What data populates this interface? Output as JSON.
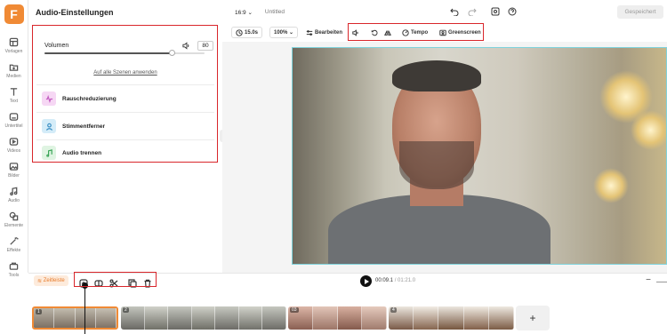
{
  "app": {
    "logo_letter": "F",
    "brand_color": "#f08a35"
  },
  "sidebar": {
    "items": [
      {
        "label": "Vorlagen",
        "icon": "template-icon"
      },
      {
        "label": "Medien",
        "icon": "media-icon"
      },
      {
        "label": "Text",
        "icon": "text-icon"
      },
      {
        "label": "Untertitel",
        "icon": "subtitles-icon"
      },
      {
        "label": "Videos",
        "icon": "video-icon"
      },
      {
        "label": "Bilder",
        "icon": "image-icon"
      },
      {
        "label": "Audio",
        "icon": "audio-icon"
      },
      {
        "label": "Elemente",
        "icon": "elements-icon"
      },
      {
        "label": "Effekte",
        "icon": "effects-icon"
      },
      {
        "label": "Tools",
        "icon": "tools-icon"
      }
    ]
  },
  "panel": {
    "title": "Audio-Einstellungen",
    "volume": {
      "label": "Volumen",
      "value": "80",
      "level_fraction": 0.8
    },
    "apply_all": "Auf alle Szenen anwenden",
    "features": [
      {
        "label": "Rauschreduzierung",
        "icon": "noise-reduction-icon",
        "color": "#f6d7f4"
      },
      {
        "label": "Stimmentferner",
        "icon": "voice-remover-icon",
        "color": "#d4ecf8"
      },
      {
        "label": "Audio trennen",
        "icon": "audio-split-icon",
        "color": "#dff4e2"
      }
    ]
  },
  "topbar": {
    "aspect_ratio": "16:9",
    "project_name": "Untitled",
    "save_label": "Gespeichert"
  },
  "toolbar": {
    "duration": "15.0s",
    "zoom": "100%",
    "edit_label": "Bearbeiten",
    "tempo_label": "Tempo",
    "greenscreen_label": "Greenscreen"
  },
  "timeline": {
    "scenes_label": "Zeitleiste",
    "current_time": "00:09.1",
    "total_time": "01:21.0",
    "clips": [
      {
        "number": "1"
      },
      {
        "number": "2"
      },
      {
        "number": "03"
      },
      {
        "number": "4"
      }
    ],
    "add_label": "+"
  },
  "highlight_color": "#d9262b"
}
